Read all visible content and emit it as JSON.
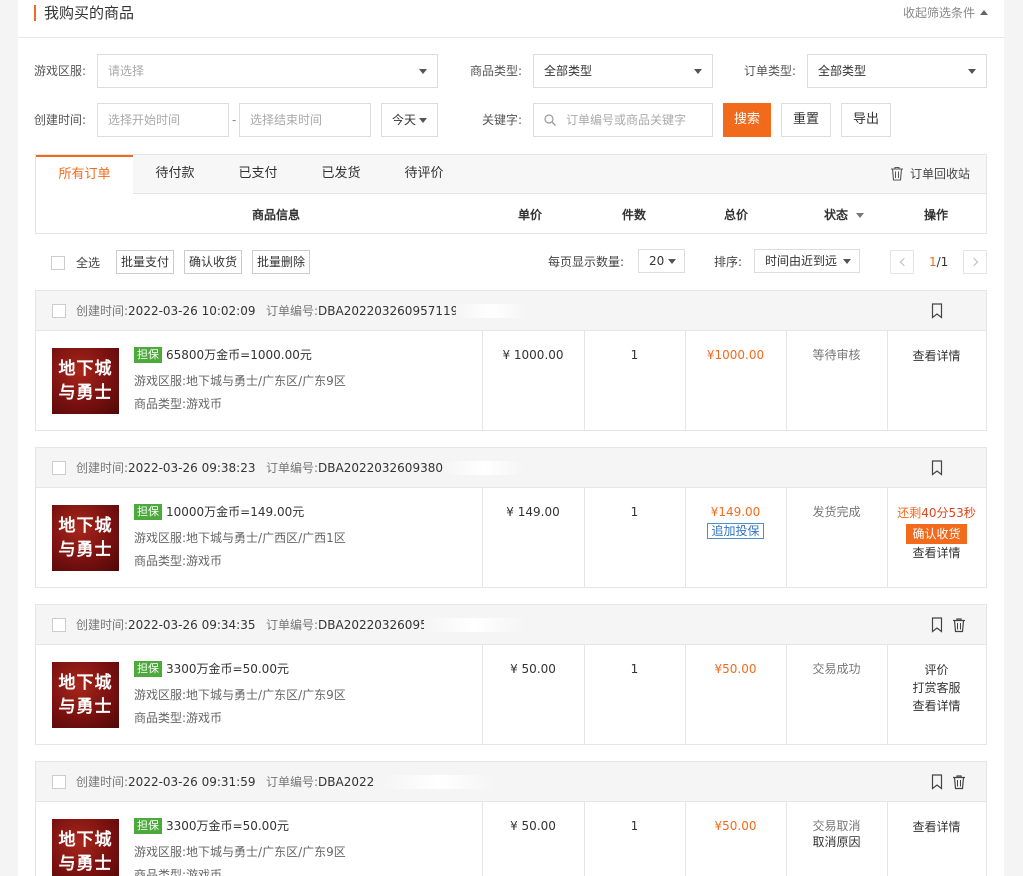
{
  "header": {
    "title": "我购买的商品",
    "collapse_label": "收起筛选条件"
  },
  "filters": {
    "server_label": "游戏区服:",
    "server_placeholder": "请选择",
    "goods_type_label": "商品类型:",
    "goods_type_value": "全部类型",
    "order_type_label": "订单类型:",
    "order_type_value": "全部类型",
    "created_label": "创建时间:",
    "start_placeholder": "选择开始时间",
    "end_placeholder": "选择结束时间",
    "range_sep": "-",
    "range_value": "今天",
    "keyword_label": "关键字:",
    "keyword_placeholder": "订单编号或商品关键字",
    "search_label": "搜索",
    "reset_label": "重置",
    "export_label": "导出"
  },
  "tabs": [
    {
      "label": "所有订单",
      "active": true
    },
    {
      "label": "待付款"
    },
    {
      "label": "已支付"
    },
    {
      "label": "已发货"
    },
    {
      "label": "待评价"
    }
  ],
  "recycle_label": "订单回收站",
  "columns": {
    "info": "商品信息",
    "unit_price": "单价",
    "qty": "件数",
    "total": "总价",
    "status": "状态",
    "ops": "操作"
  },
  "toolbar": {
    "select_all": "全选",
    "batch_pay": "批量支付",
    "confirm_receipt": "确认收货",
    "batch_delete": "批量删除",
    "page_size_label": "每页显示数量:",
    "page_size": "20",
    "sort_label": "排序:",
    "sort_value": "时间由近到远",
    "page_current": "1",
    "page_total": "/1"
  },
  "labels": {
    "created": "创建时间:",
    "order_no": "订单编号:",
    "server": "游戏区服:",
    "goods_type": "商品类型:",
    "guarantee": "担保",
    "thumb_line1": "地下城",
    "thumb_line2": "与勇士"
  },
  "orders": [
    {
      "created": "2022-03-26 10:02:09",
      "order_no": "DBA20220326095711​9",
      "title": "65800万金币=1000.00元",
      "server": "地下城与勇士/广东区/广东9区",
      "goods_type": "游戏币",
      "unit_price": "¥ 1000.00",
      "qty": "1",
      "total": "¥1000.00",
      "status": "等待审核",
      "ops": [
        "查看详情"
      ]
    },
    {
      "created": "2022-03-26 09:38:23",
      "order_no": "DBA20220326093801",
      "title": "10000万金币=149.00元",
      "server": "地下城与勇士/广西区/广西1区",
      "goods_type": "游戏币",
      "unit_price": "¥ 149.00",
      "qty": "1",
      "total": "¥149.00",
      "add_insurance": "追加投保",
      "status": "发货完成",
      "countdown_prefix": "还剩",
      "countdown": "40分53秒",
      "confirm_btn": "确认收货",
      "ops": [
        "查看详情"
      ]
    },
    {
      "created": "2022-03-26 09:34:35",
      "order_no": "DBA20220326095",
      "title": "3300万金币=50.00元",
      "server": "地下城与勇士/广东区/广东9区",
      "goods_type": "游戏币",
      "unit_price": "¥ 50.00",
      "qty": "1",
      "total": "¥50.00",
      "status": "交易成功",
      "ops": [
        "评价",
        "打赏客服",
        "查看详情"
      ]
    },
    {
      "created": "2022-03-26 09:31:59",
      "order_no": "DBA2022",
      "title": "3300万金币=50.00元",
      "server": "地下城与勇士/广东区/广东9区",
      "goods_type": "游戏币",
      "unit_price": "¥ 50.00",
      "qty": "1",
      "total": "¥50.00",
      "status": "交易取消",
      "status_link": "取消原因",
      "ops": [
        "查看详情"
      ]
    }
  ]
}
